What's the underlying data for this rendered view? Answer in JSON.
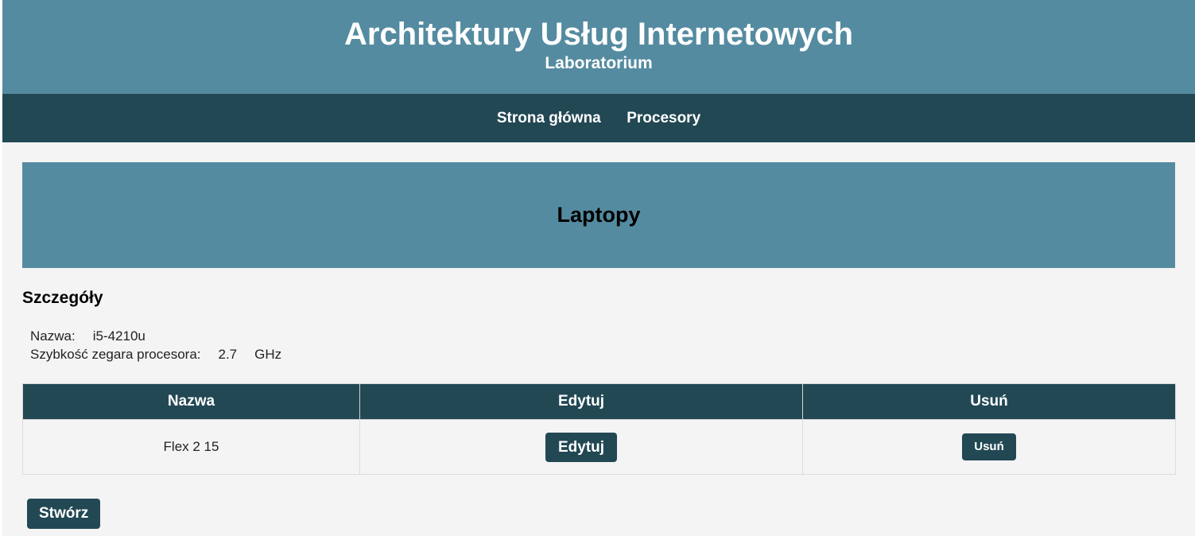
{
  "header": {
    "title": "Architektury Usług Internetowych",
    "subtitle": "Laboratorium"
  },
  "nav": {
    "items": [
      {
        "label": "Strona główna"
      },
      {
        "label": "Procesory"
      }
    ]
  },
  "banner": {
    "title": "Laptopy"
  },
  "details": {
    "title": "Szczegóły",
    "name_label": "Nazwa:",
    "name_value": "i5-4210u",
    "clock_label": "Szybkość zegara procesora:",
    "clock_value": "2.7",
    "clock_unit": "GHz"
  },
  "table": {
    "columns": [
      "Nazwa",
      "Edytuj",
      "Usuń"
    ],
    "rows": [
      {
        "name": "Flex 2 15",
        "edit_label": "Edytuj",
        "delete_label": "Usuń"
      }
    ]
  },
  "actions": {
    "create_label": "Stwórz"
  },
  "colors": {
    "header_bg": "#548ba0",
    "nav_bg": "#224854",
    "page_bg": "#f4f4f4",
    "button_bg": "#224854"
  }
}
